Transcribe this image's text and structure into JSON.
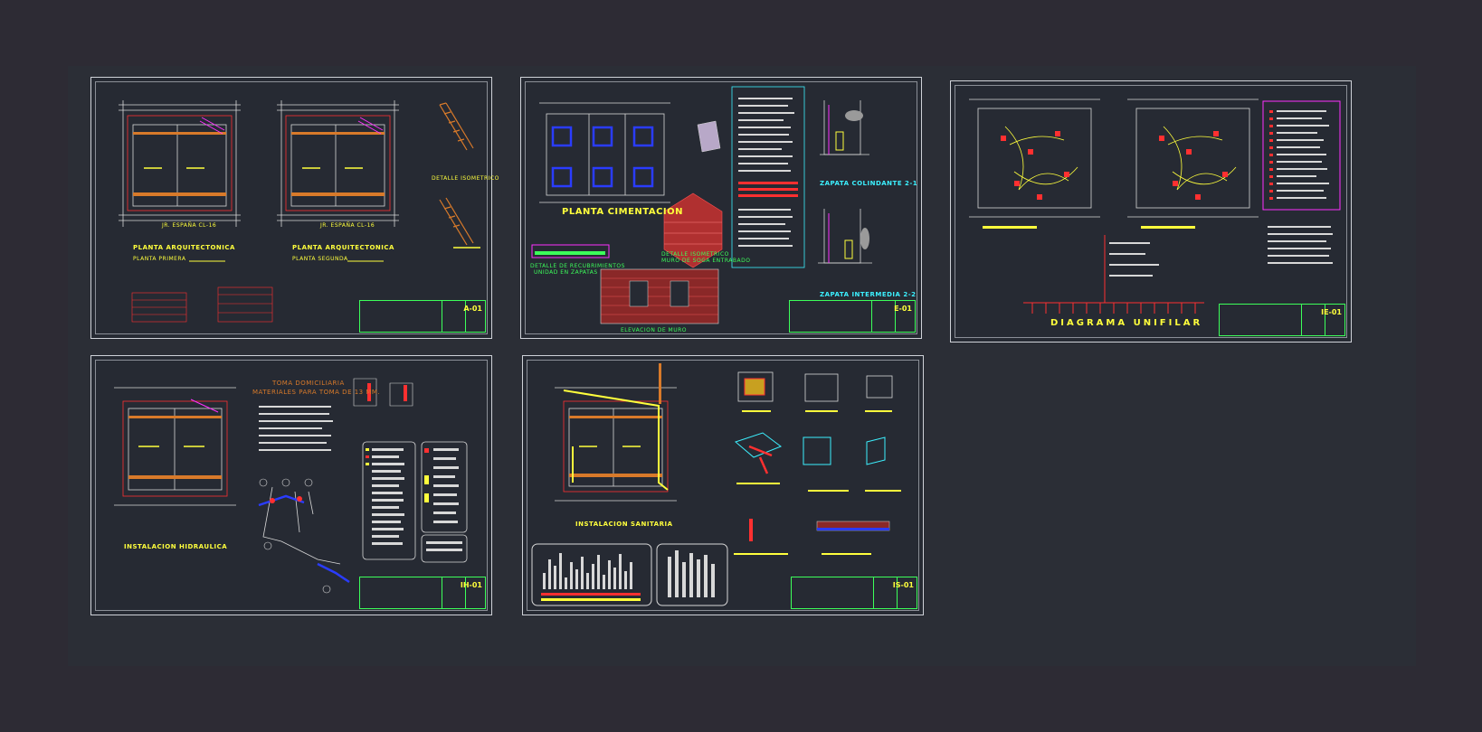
{
  "sheets": {
    "arq": {
      "plan_left_caption": "JR. ESPAÑA CL-16",
      "plan_right_caption": "JR. ESPAÑA CL-16",
      "title_left": "PLANTA ARQUITECTONICA",
      "sub_left": "PLANTA PRIMERA",
      "title_right": "PLANTA ARQUITECTONICA",
      "sub_right": "PLANTA SEGUNDA",
      "detail_label": "DETALLE ISOMETRICO",
      "tb_sheet": "A-01"
    },
    "cim": {
      "title": "PLANTA CIMENTACION",
      "detail1": "DETALLE DE RECUBRIMIENTOS",
      "detail1b": "UNIDAD EN ZAPATAS",
      "detail2": "DETALLE ISOMETRICO",
      "detail2b": "MURO DE SOGA ENTRABADO",
      "zap1": "ZAPATA COLINDANTE 2-1",
      "zap2": "ZAPATA INTERMEDIA 2-2",
      "section": "ELEVACION DE MURO",
      "tb_sheet": "E-01"
    },
    "ele": {
      "diagram": "DIAGRAMA UNIFILAR",
      "tb_sheet": "IE-01"
    },
    "hid": {
      "title": "INSTALACION HIDRAULICA",
      "note1": "TOMA DOMICILIARIA",
      "note2": "MATERIALES PARA TOMA DE 13 MM.",
      "tb_sheet": "IH-01"
    },
    "san": {
      "title": "INSTALACION SANITARIA",
      "tb_sheet": "IS-01"
    }
  },
  "colors": {
    "background": "#2d2b34",
    "sheet": "#262a33",
    "yellow": "#ffff3c",
    "green": "#3cff5a",
    "cyan": "#3cf0ff",
    "red": "#ff3030",
    "blue": "#2a3cff",
    "magenta": "#ff30ff",
    "orange": "#d87a2a"
  }
}
